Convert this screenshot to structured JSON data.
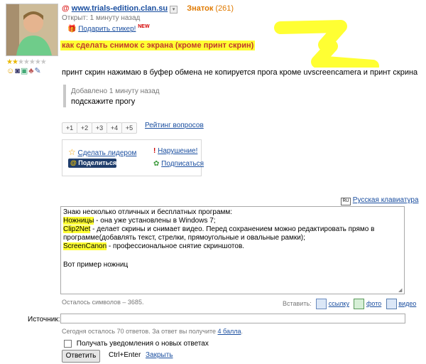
{
  "question": {
    "site_link": "www.trials-edition.clan.su",
    "rank": "Знаток",
    "rank_points": "(261)",
    "opened": "Открыт: 1 минуту назад",
    "gift_sticker": "Подарить стикер!",
    "new_badge": "NEW",
    "title": "как сделать снимок с экрана (кроме принт скрин)",
    "body": "принт скрин нажимаю в буфер обмена не копируется прога кроме uvscreencamera и принт скрина",
    "addition_time": "Добавлено 1 минуту назад",
    "addition_text": "подскажите прогу"
  },
  "rating": {
    "buttons": [
      "+1",
      "+2",
      "+3",
      "+4",
      "+5"
    ],
    "link": "Рейтинг вопросов"
  },
  "actions": {
    "leader": "Сделать лидером",
    "violation": "Нарушение!",
    "share": "Поделиться",
    "subscribe": "Подписаться"
  },
  "editor": {
    "keyboard_link": "Русская клавиатура",
    "lines": [
      {
        "text": "Знаю несколько отличных и бесплатных программ:"
      },
      {
        "hl": "Ножницы",
        "text": " - она уже установлены в Windows 7;"
      },
      {
        "hl": "Clip2Net",
        "text": " - делает скрины и снимает видео. Перед сохранением можно редактировать прямо в программе(добавлять текст, стрелки, прямоугольные и овальные рамки);"
      },
      {
        "hl": "ScreenCanon",
        "text": " - профессиональное снятие скриншотов."
      },
      {
        "text": ""
      },
      {
        "text": "Вот пример ножниц"
      }
    ],
    "chars_left": "Осталось символов – 3685.",
    "insert_label": "Вставить:",
    "insert_link": "ссылку",
    "insert_photo": "фото",
    "insert_video": "видео"
  },
  "source": {
    "label": "Источник:",
    "value": ""
  },
  "footer": {
    "today_info": "Сегодня осталось 70 ответов. За ответ вы получите",
    "points_link": "4 балла",
    "notify_label": "Получать уведомления о новых ответах",
    "submit": "Ответить",
    "hotkey": "Ctrl+Enter",
    "close": "Закрыть"
  },
  "colors": {
    "link": "#1b4fa0",
    "rank": "#e07a00",
    "highlight": "#ffff33",
    "new_badge": "#d40000"
  }
}
